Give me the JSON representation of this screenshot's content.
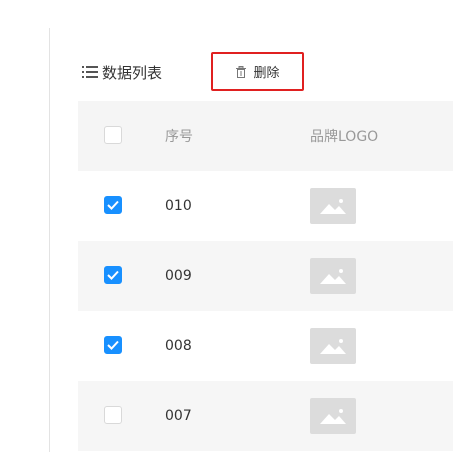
{
  "toolbar": {
    "title": "数据列表",
    "delete_label": "删除"
  },
  "table": {
    "columns": [
      "",
      "序号",
      "品牌LOGO"
    ],
    "rows": [
      {
        "seq": "010",
        "checked": true
      },
      {
        "seq": "009",
        "checked": true
      },
      {
        "seq": "008",
        "checked": true
      },
      {
        "seq": "007",
        "checked": false
      }
    ]
  },
  "colors": {
    "accent": "#1890ff",
    "highlight_border": "#e02020",
    "header_bg": "#f5f5f5"
  },
  "icons": {
    "list": "list-icon",
    "delete": "trash-icon",
    "logo": "image-placeholder-icon"
  }
}
